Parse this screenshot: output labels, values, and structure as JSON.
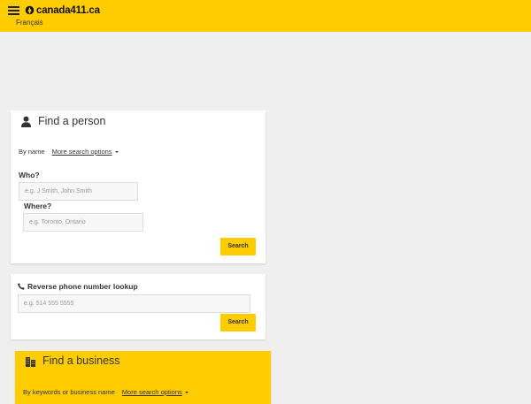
{
  "header": {
    "site_name": "canada411.ca",
    "language_link": "Français",
    "menu_icon": "hamburger-menu-icon",
    "logo_icon": "canada411-logo-icon",
    "bg_color": "#ffcc00"
  },
  "find_person": {
    "title": "Find a person",
    "title_icon": "person-icon",
    "tab_by_name": "By name",
    "more_options": "More search options",
    "who_label": "Who?",
    "who_placeholder": "e.g. J Smith, John Smith",
    "where_label": "Where?",
    "where_placeholder": "e.g. Toronto, Ontario",
    "search_label": "Search"
  },
  "reverse_lookup": {
    "title": "Reverse phone number lookup",
    "title_icon": "phone-icon",
    "phone_placeholder": "e.g. 514 555 5555",
    "search_label": "Search"
  },
  "find_business": {
    "title": "Find a business",
    "title_icon": "building-icon",
    "tab_by_keyword": "By keywords or business name",
    "more_options": "More search options"
  }
}
